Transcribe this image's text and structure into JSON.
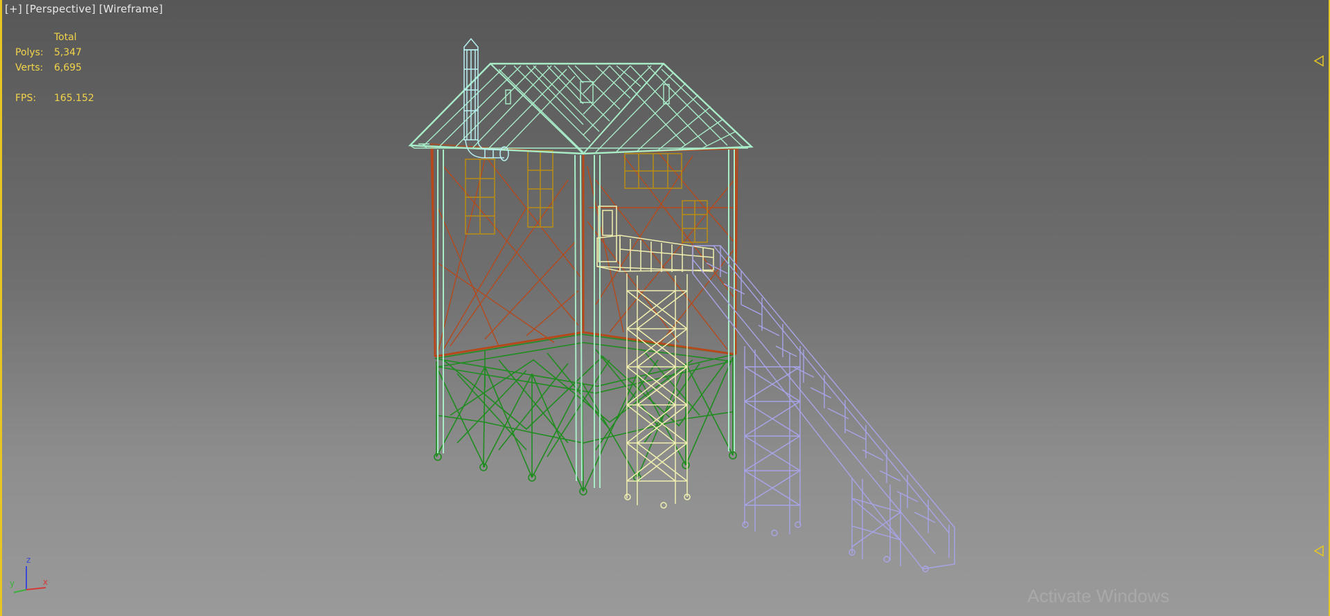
{
  "viewport": {
    "label_plus": "[+]",
    "label_view": "[Perspective]",
    "label_shading": "[Wireframe]"
  },
  "stats": {
    "header": "Total",
    "polys_label": "Polys:",
    "polys_value": "5,347",
    "verts_label": "Verts:",
    "verts_value": "6,695",
    "fps_label": "FPS:",
    "fps_value": "165.152"
  },
  "axis_gizmo": {
    "z": "z",
    "y": "y",
    "x": "x"
  },
  "watermark": "Activate Windows",
  "colors": {
    "stats_text": "#f2d44a",
    "viewport_border": "#e6c622",
    "roof": "#a8ecc8",
    "chimney": "#b8f0f2",
    "walls": "#b5491c",
    "windows": "#b98c14",
    "base": "#1f8c1f",
    "tower": "#f1f0b0",
    "stairs": "#a7a4e8",
    "axis_x": "#d23a3a",
    "axis_y": "#3ab03a",
    "axis_z": "#3a4ad6"
  }
}
